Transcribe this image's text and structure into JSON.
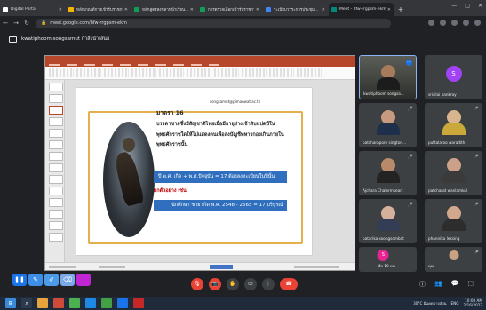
{
  "browser": {
    "tabs": [
      {
        "title": "Digital Portal",
        "color": "#ffffff",
        "active": false
      },
      {
        "title": "หลักเกณฑ์การเข้ารับราชการทหาร...",
        "color": "#f4b400",
        "active": false
      },
      {
        "title": "หลักสูตรสงขลาหน้าเรียน...",
        "color": "#0f9d58",
        "active": false
      },
      {
        "title": "การตรวจเลือกเข้ารับราชการทหาร...",
        "color": "#0f9d58",
        "active": false
      },
      {
        "title": "ระเบียบวาระการประชุม...",
        "color": "#4285f4",
        "active": false
      },
      {
        "title": "Meet - hfw-rrgpsm-ekm",
        "color": "#00897b",
        "active": true
      }
    ],
    "new_tab": "+",
    "url": "meet.google.com/hfw-rrgpsm-ekm",
    "window_controls": {
      "minimize": "—",
      "maximize": "□",
      "close": "✕"
    }
  },
  "meet": {
    "presenter_label": "kwatiphoom songsamut กำลังนำเสนอ",
    "slide": {
      "email": "songsamut@pimanwat.ac.th",
      "heading": "มาตรา 16",
      "body": "บรรดาชายซึ่งมีสัญชาติไทยเมื่อมีอายุย่างเข้าสิบแปดปีในพุทธศักราชใดให้ไปแสดงตนเพื่อลงบัญชีทหารกองเกินภายในพุทธศักราชนั้น",
      "bar1": "ปี พ.ศ. เกิด + พ.ศ.ปัจจุบัน = 17 ต้องลงทะเบียนในปีนั้น",
      "example": "ยกตัวอย่าง เช่น",
      "bar2": "นักศึกษา ชาย เกิด พ.ศ. 2548 - 2565 = 17 บริบูรณ์"
    },
    "participants": [
      {
        "name": "kwatiphoom songsa...",
        "type": "video",
        "speaking": true
      },
      {
        "name": "srisilai pankroy",
        "type": "avatar",
        "initial": "S",
        "color": "#a142f4"
      },
      {
        "name": "patcharaporn sington...",
        "type": "person",
        "skin": "#c79a7f",
        "shirt": "#1d2f4a"
      },
      {
        "name": "puttalaroo waradith",
        "type": "person",
        "skin": "#d8b58e",
        "shirt": "#caa83a"
      },
      {
        "name": "Ajchara Chalermkeart",
        "type": "person",
        "skin": "#b88a6a",
        "shirt": "#232323"
      },
      {
        "name": "patcharat wanlamkul",
        "type": "person",
        "skin": "#cba18a",
        "shirt": "#3b3b3b"
      },
      {
        "name": "patarika soongsombat",
        "type": "person",
        "skin": "#d5b09a",
        "shirt": "#333d55"
      },
      {
        "name": "phannika leksing",
        "type": "person",
        "skin": "#d2a88c",
        "shirt": "#2d2d2d"
      },
      {
        "name": "อีก 10 คน",
        "type": "avatar",
        "initial": "S",
        "color": "#e52592"
      },
      {
        "name": "คุณ",
        "type": "person",
        "skin": "#c9a183",
        "shirt": "#464646"
      }
    ],
    "controls": {
      "mic": "🎙",
      "camera": "📷",
      "raise_hand": "✋",
      "present": "▭",
      "more": "⋮",
      "end_call": "☎",
      "info": "ⓘ",
      "people": "👥",
      "chat": "💬",
      "activities": "⬚"
    }
  },
  "taskbar": {
    "weather": "30°C มีแดดบางส่วน",
    "language": "ENG",
    "time": "10:08 AM",
    "date": "2/16/2022"
  }
}
